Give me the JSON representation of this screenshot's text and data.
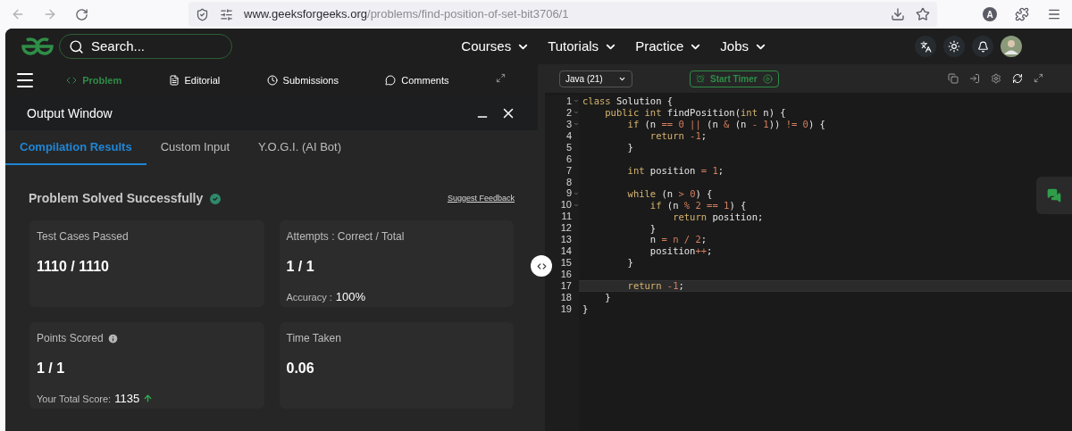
{
  "browser": {
    "url_host": "www.geeksforgeeks.org",
    "url_path": "/problems/find-position-of-set-bit3706/1",
    "profile_initial": "A"
  },
  "site_header": {
    "search": {
      "placeholder": "Search..."
    },
    "nav": [
      "Courses",
      "Tutorials",
      "Practice",
      "Jobs"
    ]
  },
  "problem_tabs": [
    {
      "label": "Problem",
      "selected": true,
      "kind": "code"
    },
    {
      "label": "Editorial",
      "selected": false,
      "kind": "doc"
    },
    {
      "label": "Submissions",
      "selected": false,
      "kind": "clock"
    },
    {
      "label": "Comments",
      "selected": false,
      "kind": "chat"
    }
  ],
  "output_window": {
    "title": "Output Window",
    "tabs": [
      {
        "label": "Compilation Results",
        "selected": true
      },
      {
        "label": "Custom Input",
        "selected": false
      },
      {
        "label": "Y.O.G.I. (AI Bot)",
        "selected": false
      }
    ],
    "status": "Problem Solved Successfully",
    "feedback_link": "Suggest Feedback",
    "cards": [
      {
        "label": "Test Cases Passed",
        "value": "1110 / 1110"
      },
      {
        "label": "Attempts : Correct / Total",
        "value": "1 / 1",
        "extra_label": "Accuracy :",
        "extra_value": "100%"
      },
      {
        "label": "Points Scored",
        "value": "1 / 1",
        "info": true,
        "extra_label": "Your Total Score:",
        "extra_value": "1135",
        "trend_up": true
      },
      {
        "label": "Time Taken",
        "value": "0.06"
      }
    ]
  },
  "editor": {
    "language": "Java (21)",
    "timer_button": "Start Timer",
    "lines": [
      {
        "number": "1",
        "fold": true,
        "active": false,
        "tokens": [
          {
            "text": "class",
            "kind": "keyword"
          },
          {
            "text": " Solution {",
            "kind": "plain"
          }
        ]
      },
      {
        "number": "2",
        "fold": true,
        "active": false,
        "tokens": [
          {
            "text": "    public int",
            "kind": "keyword"
          },
          {
            "text": " findPosition(",
            "kind": "plain"
          },
          {
            "text": "int",
            "kind": "keyword"
          },
          {
            "text": " n) {",
            "kind": "plain"
          }
        ]
      },
      {
        "number": "3",
        "fold": true,
        "active": false,
        "tokens": [
          {
            "text": "        if",
            "kind": "keyword"
          },
          {
            "text": " (n ",
            "kind": "plain"
          },
          {
            "text": "== 0 ||",
            "kind": "operator"
          },
          {
            "text": " (n ",
            "kind": "plain"
          },
          {
            "text": "&",
            "kind": "operator"
          },
          {
            "text": " (n ",
            "kind": "plain"
          },
          {
            "text": "- 1",
            "kind": "operator"
          },
          {
            "text": ")) ",
            "kind": "plain"
          },
          {
            "text": "!= 0",
            "kind": "operator"
          },
          {
            "text": ") {",
            "kind": "plain"
          }
        ]
      },
      {
        "number": "4",
        "fold": false,
        "active": false,
        "tokens": [
          {
            "text": "            return",
            "kind": "keyword"
          },
          {
            "text": " -1",
            "kind": "operator"
          },
          {
            "text": ";",
            "kind": "plain"
          }
        ]
      },
      {
        "number": "5",
        "fold": false,
        "active": false,
        "tokens": [
          {
            "text": "        }",
            "kind": "plain"
          }
        ]
      },
      {
        "number": "6",
        "fold": false,
        "active": false
      },
      {
        "number": "7",
        "fold": false,
        "active": false,
        "tokens": [
          {
            "text": "        int",
            "kind": "keyword"
          },
          {
            "text": " position ",
            "kind": "plain"
          },
          {
            "text": "= 1",
            "kind": "operator"
          },
          {
            "text": ";",
            "kind": "plain"
          }
        ]
      },
      {
        "number": "8",
        "fold": false,
        "active": false
      },
      {
        "number": "9",
        "fold": true,
        "active": false,
        "tokens": [
          {
            "text": "        while",
            "kind": "keyword"
          },
          {
            "text": " (n ",
            "kind": "plain"
          },
          {
            "text": "> 0",
            "kind": "operator"
          },
          {
            "text": ") {",
            "kind": "plain"
          }
        ]
      },
      {
        "number": "10",
        "fold": true,
        "active": false,
        "tokens": [
          {
            "text": "            if",
            "kind": "keyword"
          },
          {
            "text": " (n ",
            "kind": "plain"
          },
          {
            "text": "% 2 == 1",
            "kind": "operator"
          },
          {
            "text": ") {",
            "kind": "plain"
          }
        ]
      },
      {
        "number": "11",
        "fold": false,
        "active": false,
        "tokens": [
          {
            "text": "                return",
            "kind": "keyword"
          },
          {
            "text": " position;",
            "kind": "plain"
          }
        ]
      },
      {
        "number": "12",
        "fold": false,
        "active": false,
        "tokens": [
          {
            "text": "            }",
            "kind": "plain"
          }
        ]
      },
      {
        "number": "13",
        "fold": false,
        "active": false,
        "tokens": [
          {
            "text": "            n ",
            "kind": "plain"
          },
          {
            "text": "= n / 2",
            "kind": "operator"
          },
          {
            "text": ";",
            "kind": "plain"
          }
        ]
      },
      {
        "number": "14",
        "fold": false,
        "active": false,
        "tokens": [
          {
            "text": "            position",
            "kind": "plain"
          },
          {
            "text": "++",
            "kind": "operator"
          },
          {
            "text": ";",
            "kind": "plain"
          }
        ]
      },
      {
        "number": "15",
        "fold": false,
        "active": false,
        "tokens": [
          {
            "text": "        }",
            "kind": "plain"
          }
        ]
      },
      {
        "number": "16",
        "fold": false,
        "active": false
      },
      {
        "number": "17",
        "fold": false,
        "active": true,
        "tokens": [
          {
            "text": "        return",
            "kind": "keyword"
          },
          {
            "text": " -1",
            "kind": "operator"
          },
          {
            "text": ";",
            "kind": "plain"
          }
        ]
      },
      {
        "number": "18",
        "fold": false,
        "active": false,
        "tokens": [
          {
            "text": "    }",
            "kind": "plain"
          }
        ]
      },
      {
        "number": "19",
        "fold": false,
        "active": false,
        "tokens": [
          {
            "text": "}",
            "kind": "plain"
          }
        ]
      }
    ]
  }
}
